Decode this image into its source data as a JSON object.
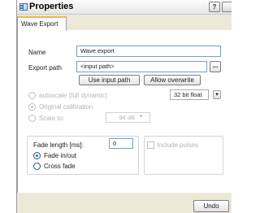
{
  "window": {
    "title": "Properties",
    "help_label": "?"
  },
  "tabs": [
    {
      "label": "Wave Export",
      "active": true
    }
  ],
  "form": {
    "name_label": "Name",
    "name_value": "Wave export",
    "export_path_label": "Export path",
    "export_path_value": "<input path>",
    "browse_label": "...",
    "use_input_path_label": "Use input path",
    "allow_overwrite_label": "Allow overwrite",
    "format_value": "32 bit float",
    "format_arrow": "▾"
  },
  "scaling": {
    "options": [
      {
        "label": "autoscale (full dynamic)",
        "selected": false,
        "enabled": false
      },
      {
        "label": "Original calibration",
        "selected": true,
        "enabled": false
      },
      {
        "label": "Scale to:",
        "selected": false,
        "enabled": false
      }
    ],
    "scale_value": "94 dB",
    "scale_arrow": "▾"
  },
  "fade": {
    "length_label": "Fade length [ms]:",
    "length_value": "0",
    "options": [
      {
        "label": "Fade in/out",
        "selected": true
      },
      {
        "label": "Cross fade",
        "selected": false
      }
    ],
    "include_pulses_label": "Include pulses"
  },
  "footer": {
    "undo_label": "Undo"
  },
  "colors": {
    "accent_tab": "#f3b44b",
    "input_border": "#7f9db9",
    "selected_radio": "#2c8a2c"
  }
}
